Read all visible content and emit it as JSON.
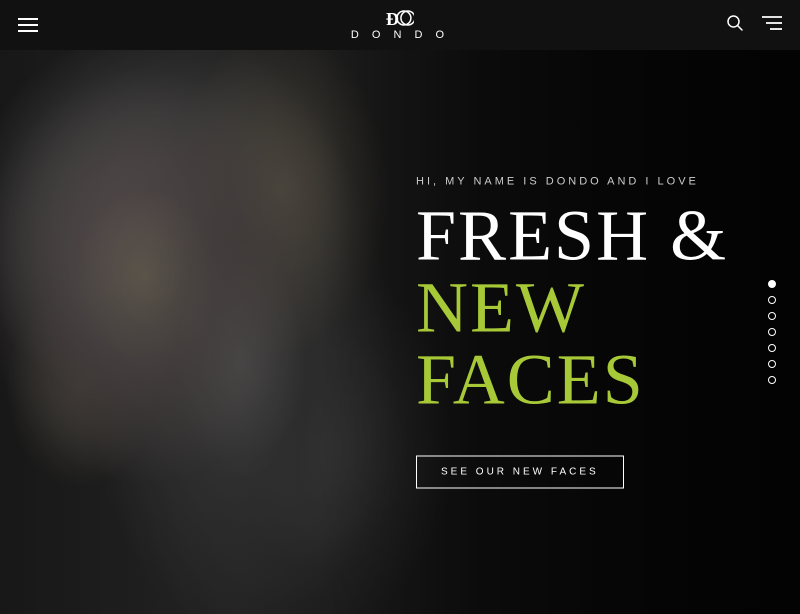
{
  "header": {
    "logo_text": "D O N D O",
    "logo_alt": "Dondo"
  },
  "hero": {
    "subtitle": "HI, MY NAME IS DONDO AND I LOVE",
    "title_line1": "FRESH &",
    "title_line2": "NEW FACES",
    "cta_label": "SEE OUR NEW FACES"
  },
  "scroll_dots": [
    {
      "id": 1,
      "active": true
    },
    {
      "id": 2,
      "active": false
    },
    {
      "id": 3,
      "active": false
    },
    {
      "id": 4,
      "active": false
    },
    {
      "id": 5,
      "active": false
    },
    {
      "id": 6,
      "active": false
    },
    {
      "id": 7,
      "active": false
    }
  ],
  "colors": {
    "accent_green": "#a8c937",
    "header_bg": "#111111",
    "hero_bg": "#1a1a1a"
  }
}
